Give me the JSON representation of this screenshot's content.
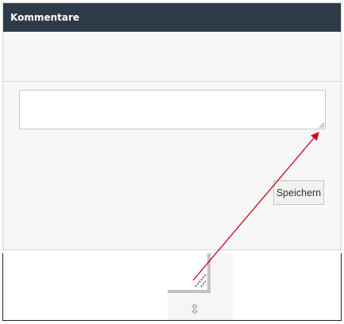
{
  "panel": {
    "title": "Kommentare"
  },
  "comment_field": {
    "value": "",
    "placeholder": ""
  },
  "save_button": {
    "label": "Speichern"
  },
  "icons": {
    "resize_grip": "resize-grip-icon",
    "move_cursor": "move-cursor-icon"
  },
  "colors": {
    "header_bg": "#2e3a48",
    "panel_bg": "#f7f7f7",
    "annotation": "#d0021b"
  }
}
